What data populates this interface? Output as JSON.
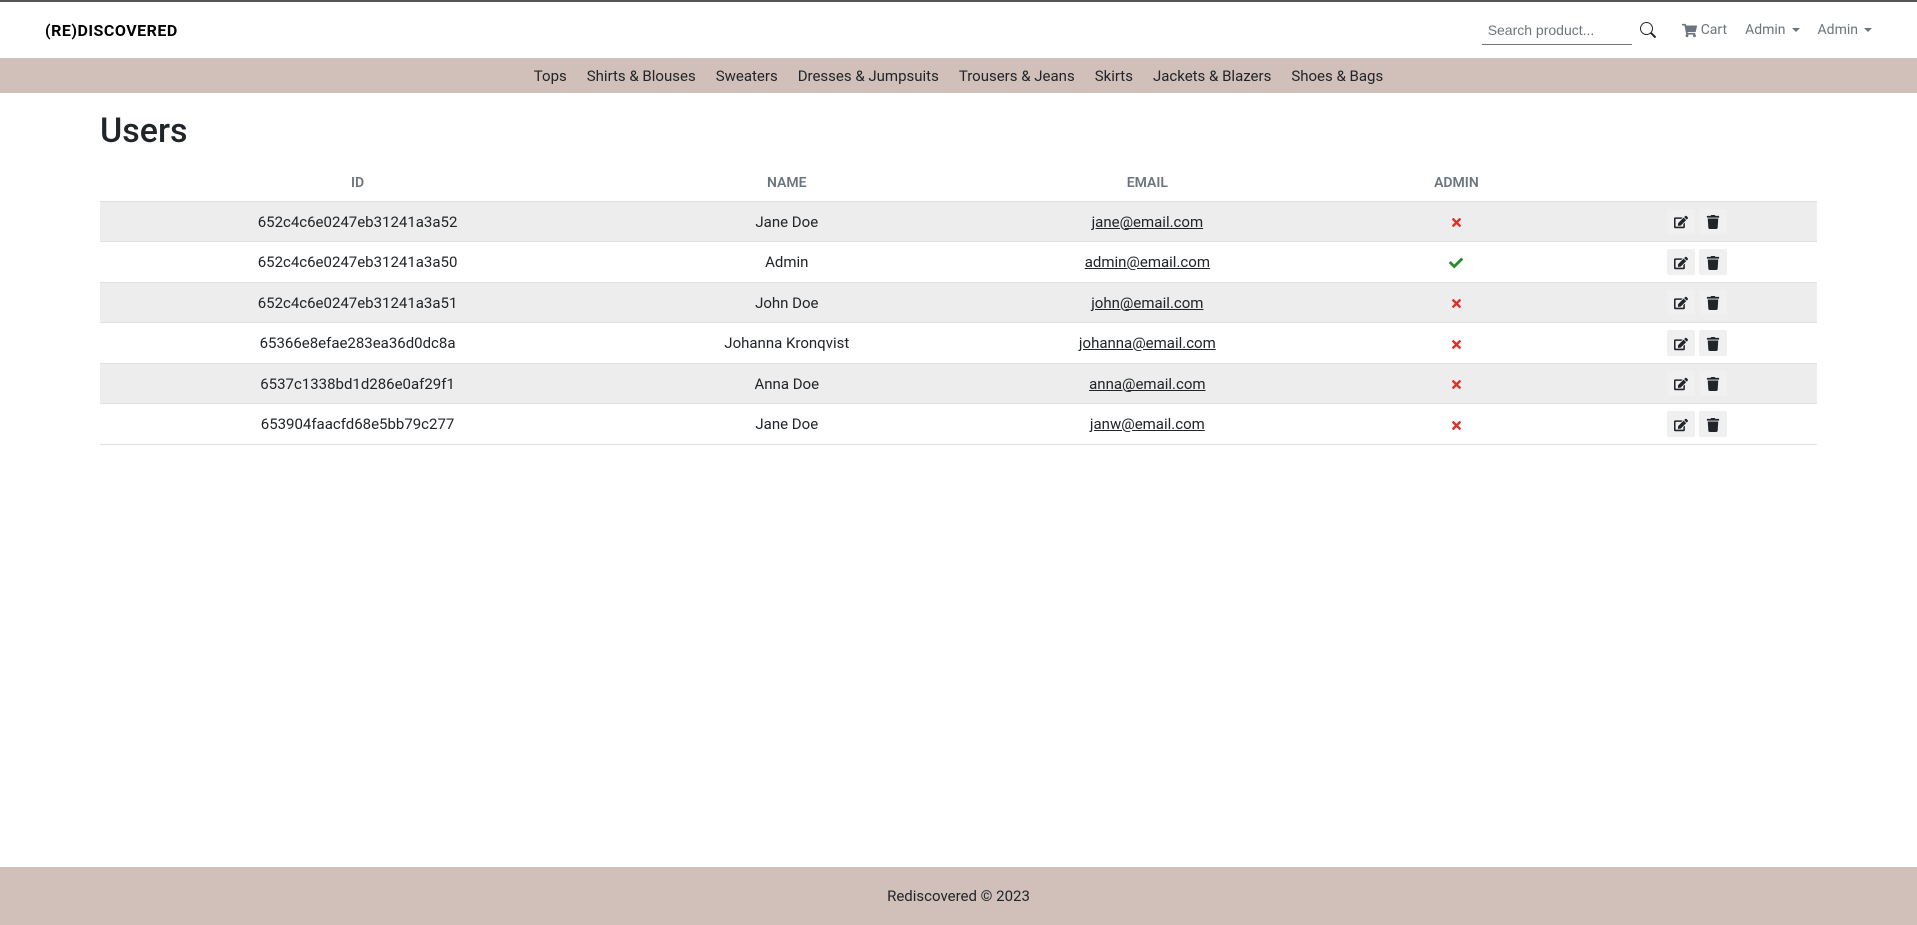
{
  "brand": "(RE)DISCOVERED",
  "search": {
    "placeholder": "Search product..."
  },
  "header": {
    "cart_label": "Cart",
    "admin1_label": "Admin",
    "admin2_label": "Admin"
  },
  "categories": [
    "Tops",
    "Shirts & Blouses",
    "Sweaters",
    "Dresses & Jumpsuits",
    "Trousers & Jeans",
    "Skirts",
    "Jackets & Blazers",
    "Shoes & Bags"
  ],
  "page_title": "Users",
  "table": {
    "headers": [
      "ID",
      "NAME",
      "EMAIL",
      "ADMIN",
      ""
    ],
    "rows": [
      {
        "id": "652c4c6e0247eb31241a3a52",
        "name": "Jane Doe",
        "email": "jane@email.com",
        "admin": false
      },
      {
        "id": "652c4c6e0247eb31241a3a50",
        "name": "Admin",
        "email": "admin@email.com",
        "admin": true
      },
      {
        "id": "652c4c6e0247eb31241a3a51",
        "name": "John Doe",
        "email": "john@email.com",
        "admin": false
      },
      {
        "id": "65366e8efae283ea36d0dc8a",
        "name": "Johanna Kronqvist",
        "email": "johanna@email.com",
        "admin": false
      },
      {
        "id": "6537c1338bd1d286e0af29f1",
        "name": "Anna Doe",
        "email": "anna@email.com",
        "admin": false
      },
      {
        "id": "653904faacfd68e5bb79c277",
        "name": "Jane Doe",
        "email": "janw@email.com",
        "admin": false
      }
    ]
  },
  "footer": "Rediscovered © 2023"
}
